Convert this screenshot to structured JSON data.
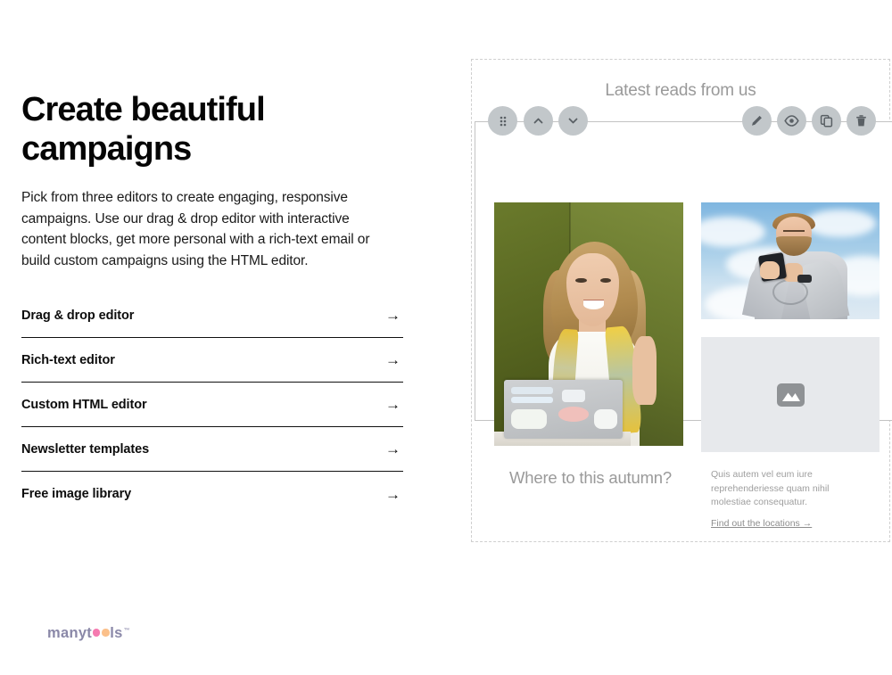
{
  "left": {
    "headline": "Create beautiful campaigns",
    "intro": "Pick from three editors to create engaging, responsive campaigns. Use our drag & drop editor with interactive content blocks, get more personal with a rich-text email or build custom campaigns using the HTML editor.",
    "links": [
      {
        "label": "Drag & drop editor",
        "arrow": "→"
      },
      {
        "label": "Rich-text editor",
        "arrow": "→"
      },
      {
        "label": "Custom HTML editor",
        "arrow": "→"
      },
      {
        "label": "Newsletter templates",
        "arrow": "→"
      },
      {
        "label": "Free image library",
        "arrow": "→"
      }
    ]
  },
  "logo": {
    "part1": "manyt",
    "part2": "ls",
    "trademark": "™",
    "text_color": "#8a88a8",
    "dot1_color": "#f57ab0",
    "dot2_color": "#fbc08a"
  },
  "builder": {
    "title": "Latest reads from us",
    "toolbar": {
      "drag_label": "drag-handle",
      "move_up_label": "move-up",
      "move_down_label": "move-down",
      "edit_label": "edit",
      "preview_label": "preview",
      "duplicate_label": "duplicate",
      "delete_label": "delete",
      "button_color": "#c2c7ca",
      "icon_color": "#5a6065"
    },
    "images": [
      {
        "name": "woman-with-laptop-photo",
        "alt": "Smiling woman holding a sticker-covered laptop in a green upholstered booth"
      },
      {
        "name": "man-with-phone-photo",
        "alt": "Bearded man in a grey sweatshirt looking at a smartphone against a blue cloudy sky"
      },
      {
        "name": "empty-image-placeholder",
        "alt": "Empty image placeholder",
        "placeholder_bg": "#e7e9ec",
        "placeholder_icon_color": "#8f9295"
      }
    ],
    "bottom_block": {
      "heading": "Where to this autumn?",
      "paragraph": "Quis autem vel eum iure reprehenderiesse quam nihil molestiae consequatur.",
      "link": "Find out the locations →"
    },
    "border_color": "#cfcfcf",
    "selected_border_color": "#c3c3c3"
  }
}
